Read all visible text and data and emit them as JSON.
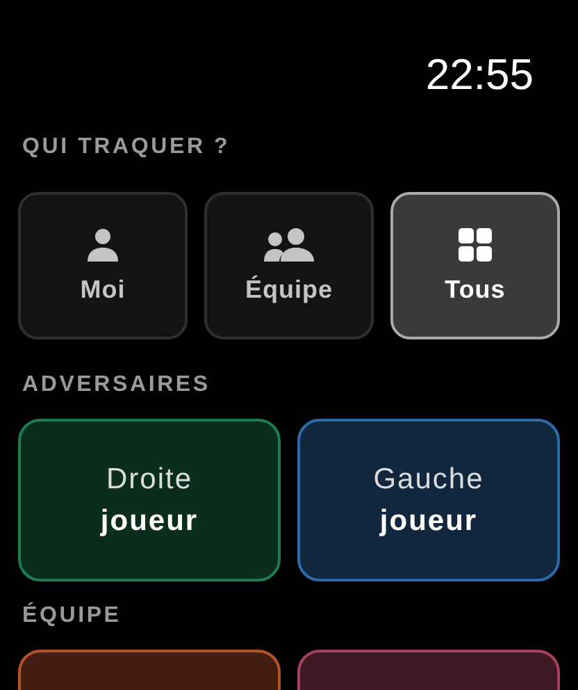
{
  "status_bar": {
    "time": "22:55"
  },
  "target_section": {
    "title": "QUI TRAQUER ?",
    "options": [
      {
        "label": "Moi",
        "kind": "person",
        "selected": false
      },
      {
        "label": "Équipe",
        "kind": "group",
        "selected": false
      },
      {
        "label": "Tous",
        "kind": "grid",
        "selected": true
      }
    ]
  },
  "opponents_section": {
    "title": "ADVERSAIRES",
    "cards": [
      {
        "line_1": "Droite",
        "line_2": "joueur",
        "color": "#1e7a52"
      },
      {
        "line_1": "Gauche",
        "line_2": "joueur",
        "color": "#2f6aa8"
      }
    ]
  },
  "team_section": {
    "title": "ÉQUIPE",
    "cards": [
      {
        "color": "#b5522a"
      },
      {
        "color": "#a8405f"
      }
    ]
  }
}
